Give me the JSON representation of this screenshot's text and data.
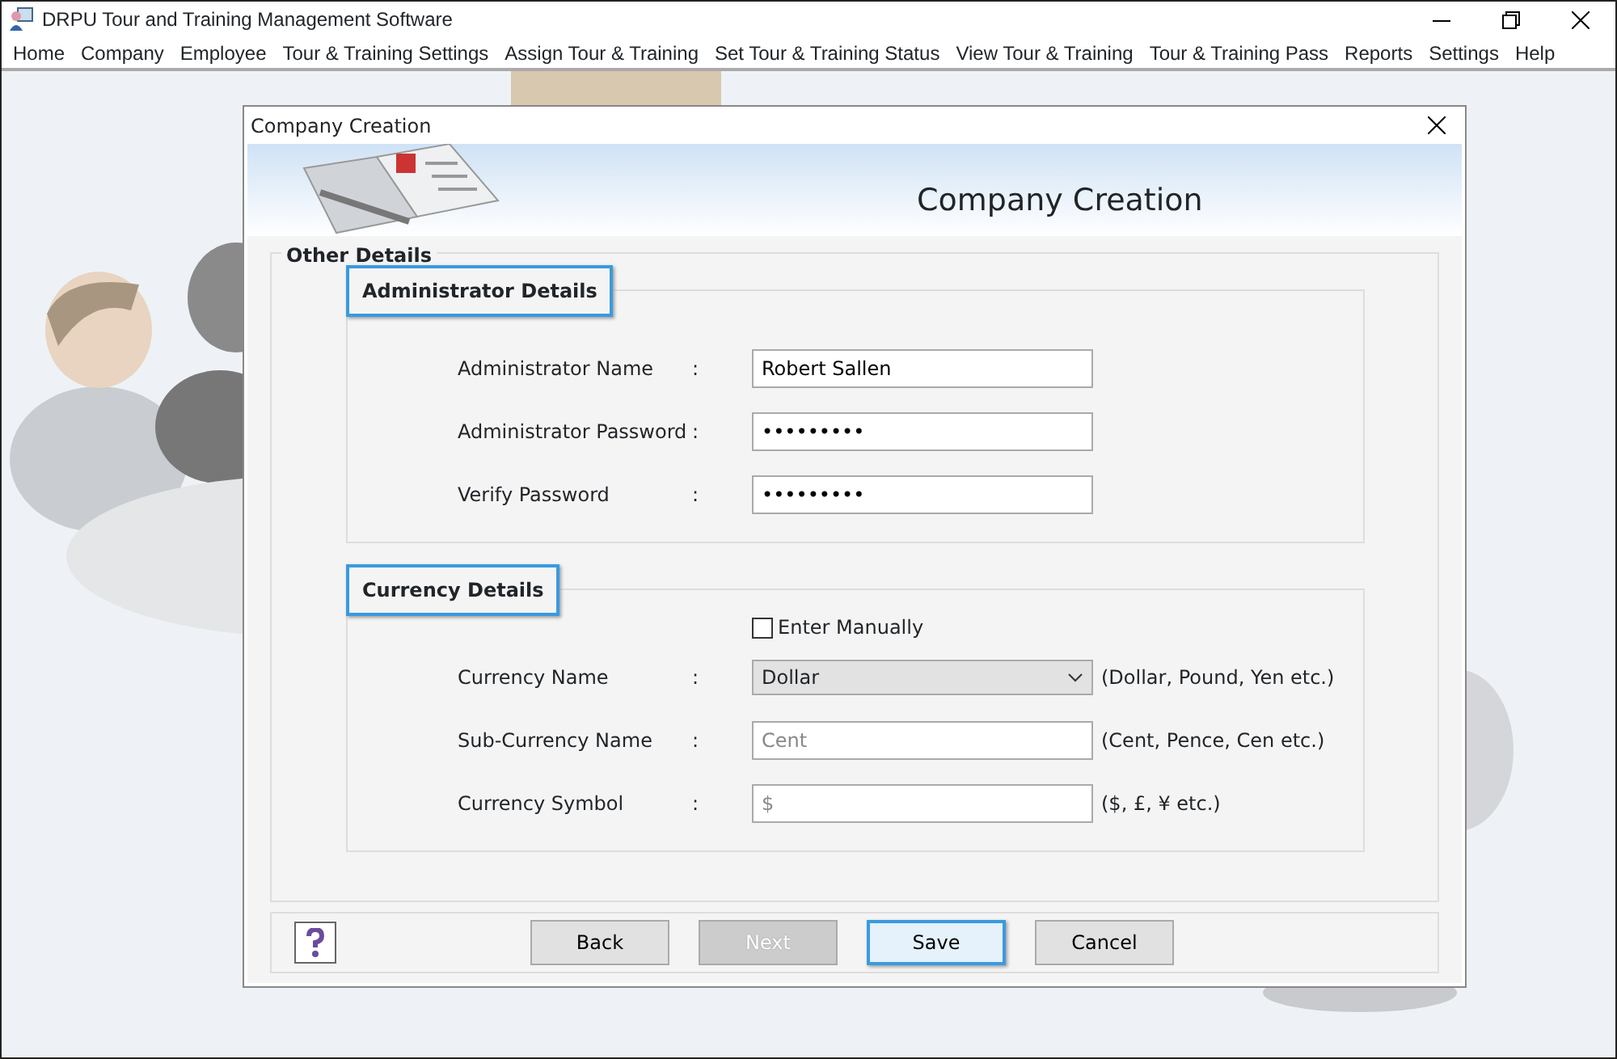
{
  "window": {
    "title": "DRPU Tour and Training Management Software"
  },
  "menu": [
    {
      "label": "Home"
    },
    {
      "label": "Company"
    },
    {
      "label": "Employee"
    },
    {
      "label": "Tour & Training Settings"
    },
    {
      "label": "Assign Tour & Training"
    },
    {
      "label": "Set Tour & Training Status"
    },
    {
      "label": "View Tour & Training"
    },
    {
      "label": "Tour & Training Pass"
    },
    {
      "label": "Reports"
    },
    {
      "label": "Settings"
    },
    {
      "label": "Help"
    }
  ],
  "dialog": {
    "title": "Company Creation",
    "heading": "Company Creation",
    "group_title": "Other Details",
    "sections": [
      {
        "title": "Administrator Details",
        "highlighted": true,
        "fields": [
          {
            "kind": "text",
            "label": "Administrator Name",
            "separator": ":",
            "value": "Robert Sallen"
          },
          {
            "kind": "text",
            "label": "Administrator Password",
            "separator": ":",
            "value": "•••••••••"
          },
          {
            "kind": "text",
            "label": "Verify Password",
            "separator": ":",
            "value": "•••••••••"
          }
        ]
      },
      {
        "title": "Currency Details",
        "highlighted": true,
        "checkbox": {
          "label": "Enter Manually",
          "checked": false
        },
        "fields": [
          {
            "kind": "select",
            "label": "Currency Name",
            "separator": ":",
            "value": "Dollar",
            "hint": "(Dollar, Pound, Yen etc.)"
          },
          {
            "kind": "text",
            "label": "Sub-Currency Name",
            "separator": ":",
            "placeholder": "Cent",
            "hint": "(Cent, Pence, Cen etc.)"
          },
          {
            "kind": "text",
            "label": "Currency Symbol",
            "separator": ":",
            "placeholder": "$",
            "hint": "($, £, ¥ etc.)"
          }
        ]
      }
    ],
    "buttons": [
      {
        "label": "Back",
        "disabled": false,
        "focused": false
      },
      {
        "label": "Next",
        "disabled": true,
        "focused": false
      },
      {
        "label": "Save",
        "disabled": false,
        "focused": true
      },
      {
        "label": "Cancel",
        "disabled": false,
        "focused": false
      }
    ]
  }
}
